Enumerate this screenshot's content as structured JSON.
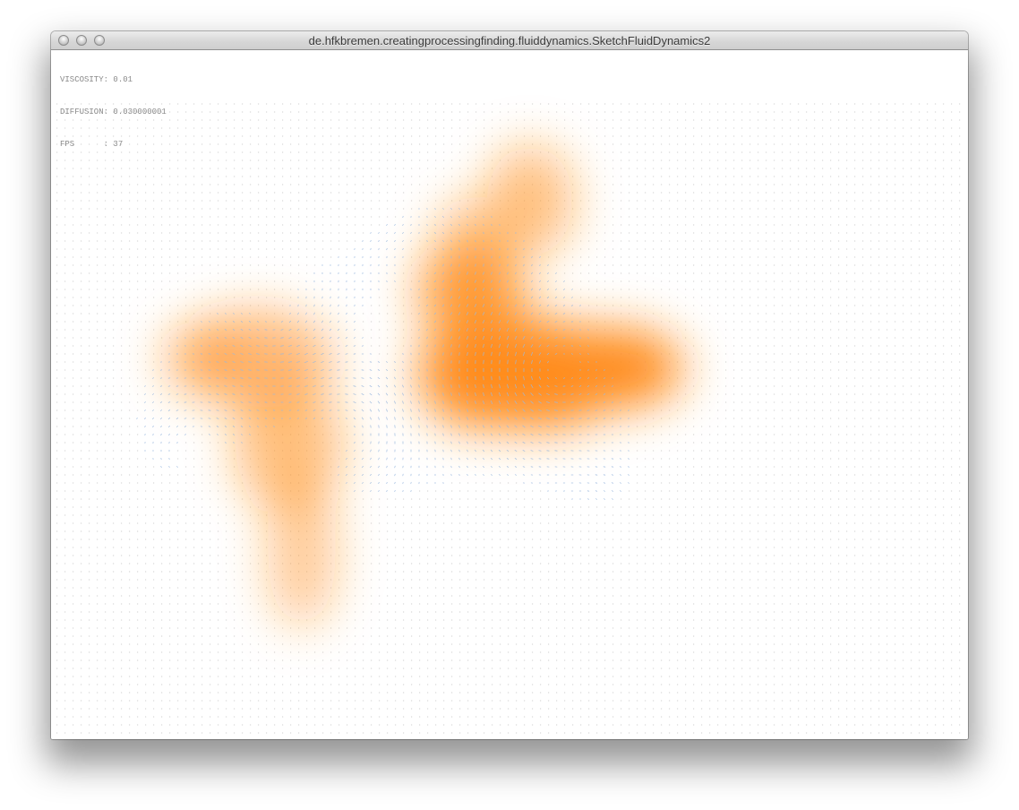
{
  "window": {
    "title": "de.hfkbremen.creatingprocessingfinding.fluiddynamics.SketchFluidDynamics2"
  },
  "hud": {
    "viscosity_label": "VISCOSITY",
    "viscosity_value": "0.01",
    "diffusion_label": "DIFFUSION",
    "diffusion_value": "0.030000001",
    "fps_label": "FPS",
    "fps_value": "37"
  },
  "colors": {
    "density": "#ff8c1a",
    "velocity_lines": "#9ab8de",
    "grid_dots": "#cfcfcf"
  }
}
